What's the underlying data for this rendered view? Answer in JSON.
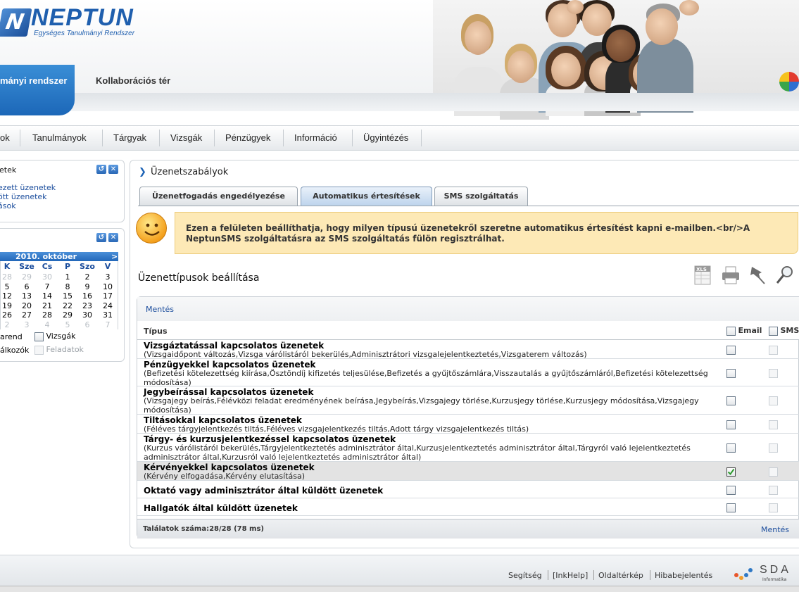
{
  "header": {
    "logo_mark": "N",
    "logo_title": "NEPTUN",
    "logo_subtitle": "Egységes Tanulmányi Rendszer",
    "tab_active": "mányi rendszer",
    "tab_collab": "Kollaborációs tér"
  },
  "menu": {
    "items": [
      "ok",
      "Tanulmányok",
      "Tárgyak",
      "Vizsgák",
      "Pénzügyek",
      "Információ",
      "Ügyintézés"
    ]
  },
  "left_panel_messages": {
    "title": "etek",
    "links": [
      "ezett üzenetek",
      "ött üzenetek",
      "ások"
    ],
    "refresh_icon": "refresh-icon",
    "close_icon": "close-icon"
  },
  "calendar": {
    "month": "2010. október",
    "next": ">",
    "weekdays": [
      "K",
      "Sze",
      "Cs",
      "P",
      "Szo",
      "V"
    ],
    "weeks": [
      [
        "28",
        "29",
        "30",
        "1",
        "2",
        "3"
      ],
      [
        "5",
        "6",
        "7",
        "8",
        "9",
        "10"
      ],
      [
        "12",
        "13",
        "14",
        "15",
        "16",
        "17"
      ],
      [
        "19",
        "20",
        "21",
        "22",
        "23",
        "24"
      ],
      [
        "26",
        "27",
        "28",
        "29",
        "30",
        "31"
      ],
      [
        "2",
        "3",
        "4",
        "5",
        "6",
        "7"
      ]
    ],
    "filters": [
      {
        "label": "arend"
      },
      {
        "label": "Vizsgák"
      },
      {
        "label": "álkozók"
      },
      {
        "label": "Feladatok"
      }
    ]
  },
  "content": {
    "title": "Üzenetszabályok",
    "tabs": [
      "Üzenetfogadás engedélyezése",
      "Automatikus értesítések",
      "SMS szolgáltatás"
    ],
    "active_tab": 1,
    "info_text": "Ezen a felületen beállíthatja, hogy milyen típusú üzenetekről szeretne automatikus értesítést kapni e-mailben.<br/>A NeptunSMS szolgáltatásra az SMS szolgáltatás fülön regisztrálhat.",
    "section_title": "Üzenettípusok beállítása",
    "toolbar_icons": [
      "xls-export-icon",
      "print-icon",
      "pin-icon",
      "search-icon"
    ],
    "xls_label": "XLS"
  },
  "grid": {
    "save_label": "Mentés",
    "col_type": "Típus",
    "col_email": "Email",
    "col_sms": "SMS",
    "rows": [
      {
        "title": "Vizsgáztatással kapcsolatos üzenetek",
        "desc": "(Vizsgaidőpont változás,Vizsga várólistáról bekerülés,Adminisztrátori vizsgalejelentkeztetés,Vizsgaterem változás)",
        "email": false,
        "sms": false
      },
      {
        "title": "Pénzügyekkel kapcsolatos üzenetek",
        "desc": "(Befizetési kötelezettség kiírása,Ösztöndíj kifizetés teljesülése,Befizetés a gyűjtőszámlára,Visszautalás a gyűjtőszámláról,Befizetési kötelezettség módosítása)",
        "email": false,
        "sms": false
      },
      {
        "title": "Jegybeírással kapcsolatos üzenetek",
        "desc": "(Vizsgajegy beírás,Félévközi feladat eredményének beírása,Jegybeírás,Vizsgajegy törlése,Kurzusjegy törlése,Kurzusjegy módosítása,Vizsgajegy módosítása)",
        "email": false,
        "sms": false
      },
      {
        "title": "Tiltásokkal kapcsolatos üzenetek",
        "desc": "(Féléves tárgyjelentkezés tiltás,Féléves vizsgajelentkezés tiltás,Adott tárgy vizsgajelentkezés tiltás)",
        "email": false,
        "sms": false
      },
      {
        "title": "Tárgy- és kurzusjelentkezéssel kapcsolatos üzenetek",
        "desc": "(Kurzus várólistáról bekerülés,Tárgyjelentkeztetés adminisztrátor által,Kurzusjelentkeztetés adminisztrátor által,Tárgyról való lejelentkeztetés adminisztrátor által,Kurzusról való lejelentkeztetés adminisztrátor által)",
        "email": false,
        "sms": false
      },
      {
        "title": "Kérvényekkel kapcsolatos üzenetek",
        "desc": "(Kérvény elfogadása,Kérvény elutasítása)",
        "email": true,
        "sms": false
      },
      {
        "title": "Oktató vagy adminisztrátor által küldött üzenetek",
        "desc": "",
        "email": false,
        "sms": false
      },
      {
        "title": "Hallgatók által küldött üzenetek",
        "desc": "",
        "email": false,
        "sms": false
      }
    ],
    "found_label": "Találatok száma:28/28 (78 ms)",
    "save_bottom": "Mentés"
  },
  "footer": {
    "links": [
      "Segítség",
      "[InkHelp]",
      "Oldaltérkép",
      "Hibabejelentés"
    ],
    "brand": "SDA",
    "brand_sub": "Informatika"
  },
  "colors": {
    "accent": "#1c67b8",
    "link": "#1a4c9c",
    "info_bg": "#fde9b6",
    "selected_row": "#e3e3e3"
  }
}
